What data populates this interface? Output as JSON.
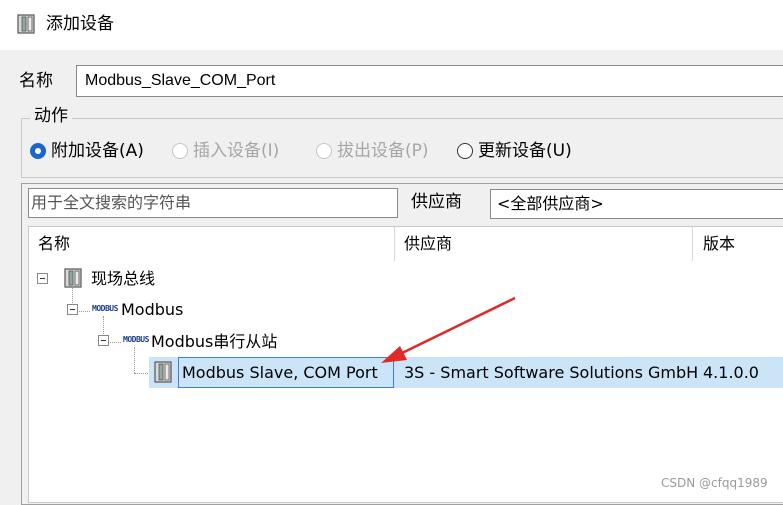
{
  "window": {
    "title": "添加设备"
  },
  "name_field": {
    "label": "名称",
    "value": "Modbus_Slave_COM_Port"
  },
  "action_group": {
    "title": "动作",
    "options": [
      {
        "label": "附加设备(A)",
        "state": "checked"
      },
      {
        "label": "插入设备(I)",
        "state": "disabled"
      },
      {
        "label": "拔出设备(P)",
        "state": "disabled"
      },
      {
        "label": "更新设备(U)",
        "state": "enabled"
      }
    ]
  },
  "search": {
    "placeholder": "用于全文搜索的字符串"
  },
  "vendor_filter": {
    "label": "供应商",
    "selected": "<全部供应商>"
  },
  "tree": {
    "columns": [
      "名称",
      "供应商",
      "版本"
    ],
    "nodes": [
      {
        "label": "现场总线",
        "icon": "device-module-icon"
      },
      {
        "label": "Modbus",
        "icon": "modbus-icon",
        "icon_text": "MODBUS"
      },
      {
        "label": "Modbus串行从站",
        "icon": "modbus-icon",
        "icon_text": "MODBUS"
      },
      {
        "label": "Modbus Slave, COM Port",
        "icon": "device-module-icon",
        "vendor": "3S - Smart Software Solutions GmbH",
        "version": "4.1.0.0",
        "selected": true
      }
    ]
  },
  "annotation": {
    "arrow_color": "#e02a2a"
  },
  "watermark": "CSDN @cfqq1989",
  "colors": {
    "radio_checked": "#1a66cc",
    "selection": "#cce4f7",
    "focus_border": "#3b7fd1"
  }
}
